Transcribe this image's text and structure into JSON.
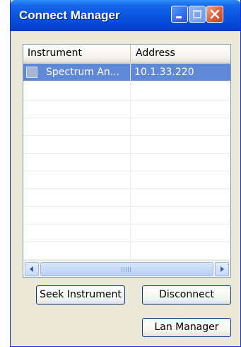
{
  "window": {
    "title": "Connect Manager",
    "controls": {
      "minimize": "minimize-icon",
      "maximize": "maximize-icon",
      "close": "close-icon"
    }
  },
  "list": {
    "columns": [
      "Instrument",
      "Address"
    ],
    "rows": [
      {
        "instrument": "Spectrum An...",
        "address": "10.1.33.220",
        "selected": true,
        "icon": "instrument-icon"
      }
    ],
    "empty_rows": 10
  },
  "scrollbar": {
    "left": "scroll-left-icon",
    "right": "scroll-right-icon"
  },
  "buttons": {
    "seek": "Seek Instrument",
    "disconnect": "Disconnect",
    "lan_manager": "Lan Manager"
  },
  "colors": {
    "title_bar": "#0a55df",
    "selection": "#5f88d7",
    "close_button": "#e05c34"
  }
}
